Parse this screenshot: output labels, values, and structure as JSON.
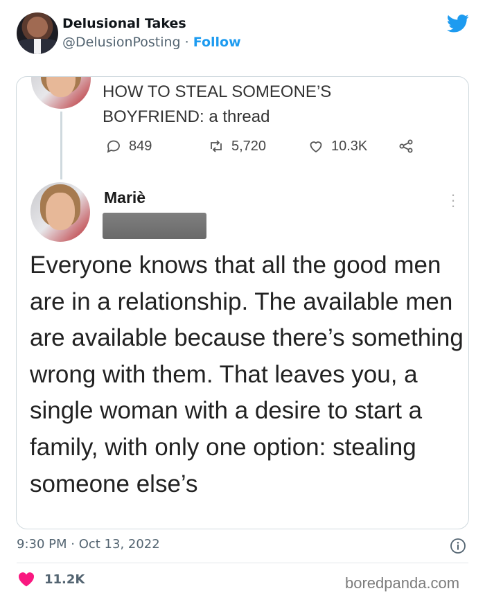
{
  "header": {
    "author_name": "Delusional Takes",
    "handle": "@DelusionPosting",
    "separator": " · ",
    "follow_label": "Follow",
    "twitter_icon": "twitter-bird-icon"
  },
  "embedded": {
    "quoted": {
      "text_line1": "HOW TO STEAL SOMEONE’S",
      "text_line2": "BOYFRIEND: a thread",
      "replies": "849",
      "retweets": "5,720",
      "likes": "10.3K"
    },
    "tweet": {
      "name": "Mariè",
      "body": "Everyone knows that all the good men are in a relationship. The available men are available because there’s something wrong with them. That leaves you, a single woman with a desire to start a family, with only one option: stealing someone else’s"
    }
  },
  "footer": {
    "timestamp": "9:30 PM · Oct 13, 2022",
    "like_count": "11.2K",
    "watermark": "boredpanda.com"
  },
  "colors": {
    "accent": "#1d9bf0",
    "heart": "#f91880",
    "muted": "#536471"
  }
}
